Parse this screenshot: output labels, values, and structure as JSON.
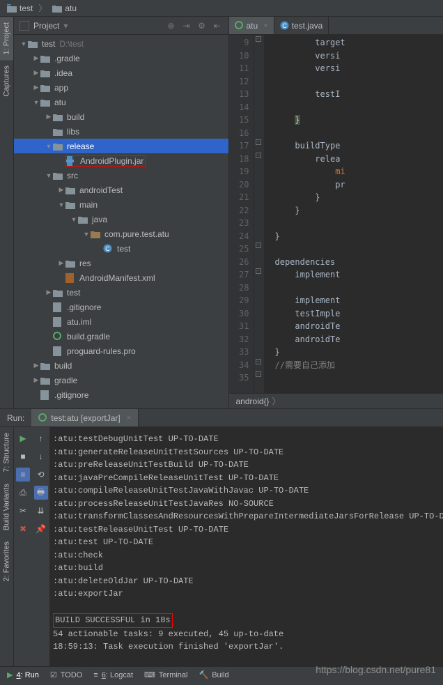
{
  "breadcrumb": {
    "items": [
      "test",
      "atu"
    ]
  },
  "panel": {
    "title": "Project"
  },
  "tree": [
    {
      "indent": 0,
      "arrow": "down",
      "icon": "folder",
      "label": "test",
      "path": "D:\\test"
    },
    {
      "indent": 1,
      "arrow": "right",
      "icon": "folder",
      "label": ".gradle"
    },
    {
      "indent": 1,
      "arrow": "right",
      "icon": "folder",
      "label": ".idea"
    },
    {
      "indent": 1,
      "arrow": "right",
      "icon": "folder",
      "label": "app"
    },
    {
      "indent": 1,
      "arrow": "down",
      "icon": "folder",
      "label": "atu"
    },
    {
      "indent": 2,
      "arrow": "right",
      "icon": "folder",
      "label": "build"
    },
    {
      "indent": 2,
      "arrow": "",
      "icon": "folder",
      "label": "libs"
    },
    {
      "indent": 2,
      "arrow": "down",
      "icon": "folder",
      "label": "release",
      "selected": true
    },
    {
      "indent": 3,
      "arrow": "",
      "icon": "jar",
      "label": "AndroidPlugin.jar",
      "highlighted": true
    },
    {
      "indent": 2,
      "arrow": "down",
      "icon": "folder",
      "label": "src"
    },
    {
      "indent": 3,
      "arrow": "right",
      "icon": "folder",
      "label": "androidTest"
    },
    {
      "indent": 3,
      "arrow": "down",
      "icon": "folder",
      "label": "main"
    },
    {
      "indent": 4,
      "arrow": "down",
      "icon": "folder",
      "label": "java"
    },
    {
      "indent": 5,
      "arrow": "down",
      "icon": "package",
      "label": "com.pure.test.atu"
    },
    {
      "indent": 6,
      "arrow": "",
      "icon": "class",
      "label": "test"
    },
    {
      "indent": 3,
      "arrow": "right",
      "icon": "folder",
      "label": "res"
    },
    {
      "indent": 3,
      "arrow": "",
      "icon": "xml",
      "label": "AndroidManifest.xml"
    },
    {
      "indent": 2,
      "arrow": "right",
      "icon": "folder",
      "label": "test"
    },
    {
      "indent": 2,
      "arrow": "",
      "icon": "file",
      "label": ".gitignore"
    },
    {
      "indent": 2,
      "arrow": "",
      "icon": "file",
      "label": "atu.iml"
    },
    {
      "indent": 2,
      "arrow": "",
      "icon": "gradle",
      "label": "build.gradle"
    },
    {
      "indent": 2,
      "arrow": "",
      "icon": "file",
      "label": "proguard-rules.pro"
    },
    {
      "indent": 1,
      "arrow": "right",
      "icon": "folder",
      "label": "build"
    },
    {
      "indent": 1,
      "arrow": "right",
      "icon": "folder",
      "label": "gradle"
    },
    {
      "indent": 1,
      "arrow": "",
      "icon": "file",
      "label": ".gitignore"
    }
  ],
  "editor": {
    "tabs": [
      {
        "name": "atu",
        "icon": "gradle",
        "active": true,
        "closable": true
      },
      {
        "name": "test.java",
        "icon": "class",
        "active": false
      }
    ],
    "startLine": 9,
    "lines": [
      "        target",
      "        versi",
      "        versi",
      "",
      "        testI",
      "",
      "    }",
      "",
      "    buildType",
      "        relea",
      "            mi",
      "            pr",
      "        }",
      "    }",
      "",
      "}",
      "",
      "dependencies",
      "    implement",
      "",
      "    implement",
      "    testImple",
      "    androidTe",
      "    androidTe",
      "}",
      "//需要自己添加",
      ""
    ],
    "breadcrumb": "android{}"
  },
  "leftTabs": [
    {
      "label": "1: Project",
      "active": true
    },
    {
      "label": "Captures",
      "active": false
    }
  ],
  "leftTabs2": [
    {
      "label": "7: Structure"
    },
    {
      "label": "Build Variants"
    },
    {
      "label": "2: Favorites"
    }
  ],
  "run": {
    "headerLabel": "Run:",
    "tabName": "test:atu [exportJar]",
    "output": [
      ":atu:testDebugUnitTest UP-TO-DATE",
      ":atu:generateReleaseUnitTestSources UP-TO-DATE",
      ":atu:preReleaseUnitTestBuild UP-TO-DATE",
      ":atu:javaPreCompileReleaseUnitTest UP-TO-DATE",
      ":atu:compileReleaseUnitTestJavaWithJavac UP-TO-DATE",
      ":atu:processReleaseUnitTestJavaRes NO-SOURCE",
      ":atu:transformClassesAndResourcesWithPrepareIntermediateJarsForRelease UP-TO-DATE",
      ":atu:testReleaseUnitTest UP-TO-DATE",
      ":atu:test UP-TO-DATE",
      ":atu:check",
      ":atu:build",
      ":atu:deleteOldJar UP-TO-DATE",
      ":atu:exportJar",
      "",
      "BUILD SUCCESSFUL in 18s",
      "54 actionable tasks: 9 executed, 45 up-to-date",
      "18:59:13: Task execution finished 'exportJar'."
    ]
  },
  "bottomBar": {
    "items": [
      {
        "label": "4: Run",
        "icon": "run",
        "active": true
      },
      {
        "label": "TODO",
        "icon": "todo"
      },
      {
        "label": "6: Logcat",
        "icon": "logcat"
      },
      {
        "label": "Terminal",
        "icon": "terminal"
      },
      {
        "label": "Build",
        "icon": "build"
      }
    ]
  },
  "watermark": "https://blog.csdn.net/pure81"
}
